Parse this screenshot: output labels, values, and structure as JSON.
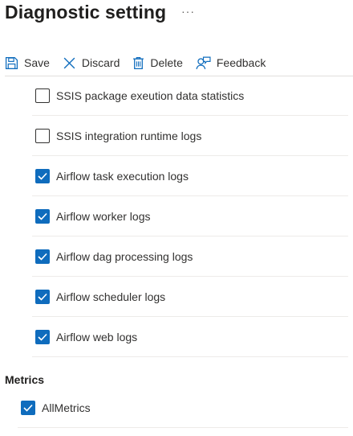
{
  "header": {
    "title": "Diagnostic setting",
    "more": "···"
  },
  "toolbar": {
    "save": "Save",
    "discard": "Discard",
    "delete": "Delete",
    "feedback": "Feedback"
  },
  "logs": [
    {
      "label": "SSIS package exeution data statistics",
      "checked": false
    },
    {
      "label": "SSIS integration runtime logs",
      "checked": false
    },
    {
      "label": "Airflow task execution logs",
      "checked": true
    },
    {
      "label": "Airflow worker logs",
      "checked": true
    },
    {
      "label": "Airflow dag processing logs",
      "checked": true
    },
    {
      "label": "Airflow scheduler logs",
      "checked": true
    },
    {
      "label": "Airflow web logs",
      "checked": true
    }
  ],
  "metrics": {
    "title": "Metrics",
    "items": [
      {
        "label": "AllMetrics",
        "checked": true
      }
    ]
  },
  "colors": {
    "accent": "#0f6cbd",
    "text": "#323130",
    "divider": "#edebe9"
  }
}
